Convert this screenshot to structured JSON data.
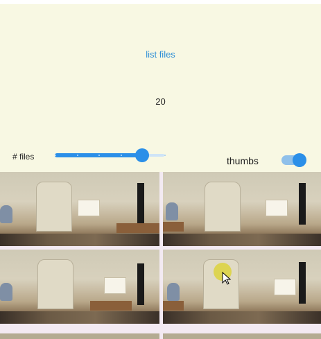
{
  "controls": {
    "list_files_label": "list files",
    "file_count": "20",
    "files_label": "# files",
    "slider_fraction": 0.8,
    "slider_ticks": 6,
    "thumbs_label": "thumbs",
    "thumbs_on": true
  },
  "colors": {
    "panel_bg": "#f8f8e3",
    "accent": "#2b8fe8",
    "link": "#2f8fd6"
  },
  "grid": {
    "thumbnails": [
      {
        "variant": "a"
      },
      {
        "variant": "b"
      },
      {
        "variant": "c"
      },
      {
        "variant": "d"
      }
    ]
  }
}
